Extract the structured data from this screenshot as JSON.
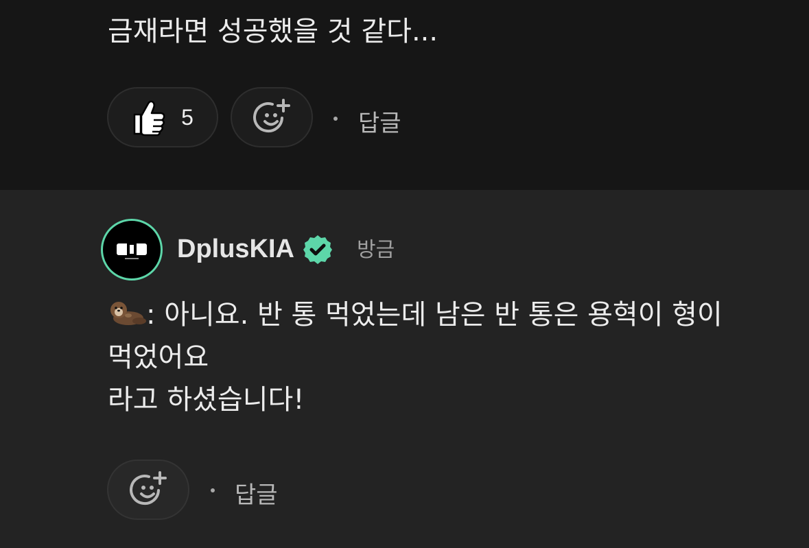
{
  "top_comment": {
    "text": "금재라면 성공했을 것 같다...",
    "like_count": "5",
    "reply_label": "답글"
  },
  "reply": {
    "author": "DplusKIA",
    "timestamp": "방금",
    "lines": [
      ": 아니요. 반 통 먹었는데 남은 반 통은 용혁이 형이",
      "먹었어요",
      "라고 하셨습니다!"
    ],
    "reply_label": "답글"
  },
  "colors": {
    "background": "#161616",
    "reply_background": "#232323",
    "verified_badge": "#5dd6a9",
    "avatar_ring": "#5dd6a9"
  },
  "icons": {
    "like": "thumbs-up-icon",
    "reaction": "add-reaction-smile-icon",
    "verified": "verified-check-icon",
    "emoji": "otter-emoji-icon"
  }
}
